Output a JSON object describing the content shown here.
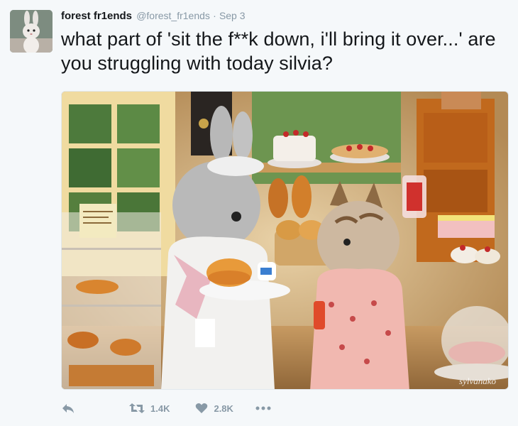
{
  "tweet": {
    "display_name": "forest fr1ends",
    "handle": "@forest_fr1ends",
    "separator": "·",
    "timestamp": "Sep 3",
    "text": "what part of 'sit the f**k down, i'll bring it over...' are you struggling with today silvia?"
  },
  "media": {
    "watermark": "sylvanako"
  },
  "actions": {
    "retweet_count": "1.4K",
    "like_count": "2.8K"
  },
  "colors": {
    "text_primary": "#14171a",
    "text_secondary": "#8899a6",
    "background": "#f5f8fa"
  },
  "icons": [
    "reply-icon",
    "retweet-icon",
    "heart-icon",
    "more-icon"
  ]
}
